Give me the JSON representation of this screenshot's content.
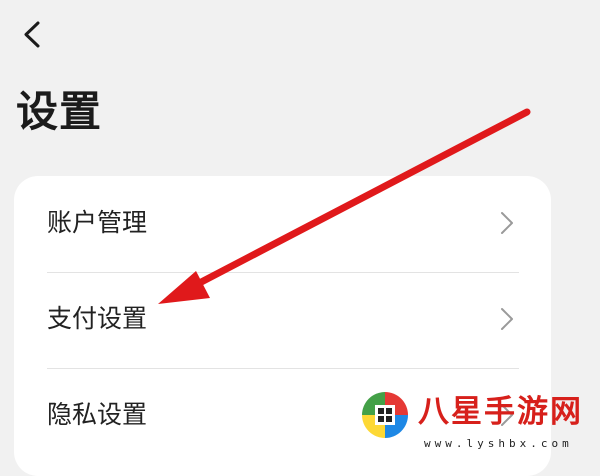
{
  "header": {
    "back_icon": "chevron-left-icon",
    "title": "设置"
  },
  "settings": {
    "items": [
      {
        "label": "账户管理",
        "icon": "chevron-right-icon"
      },
      {
        "label": "支付设置",
        "icon": "chevron-right-icon"
      },
      {
        "label": "隐私设置",
        "icon": "chevron-right-icon"
      }
    ]
  },
  "annotation": {
    "type": "arrow",
    "color": "#e0191b",
    "points_to": "支付设置"
  },
  "watermark": {
    "brand": "八星手游网",
    "url": "www.lyshbx.com"
  },
  "colors": {
    "background": "#f1f1f1",
    "card": "#ffffff",
    "accent_red": "#e0191b"
  }
}
